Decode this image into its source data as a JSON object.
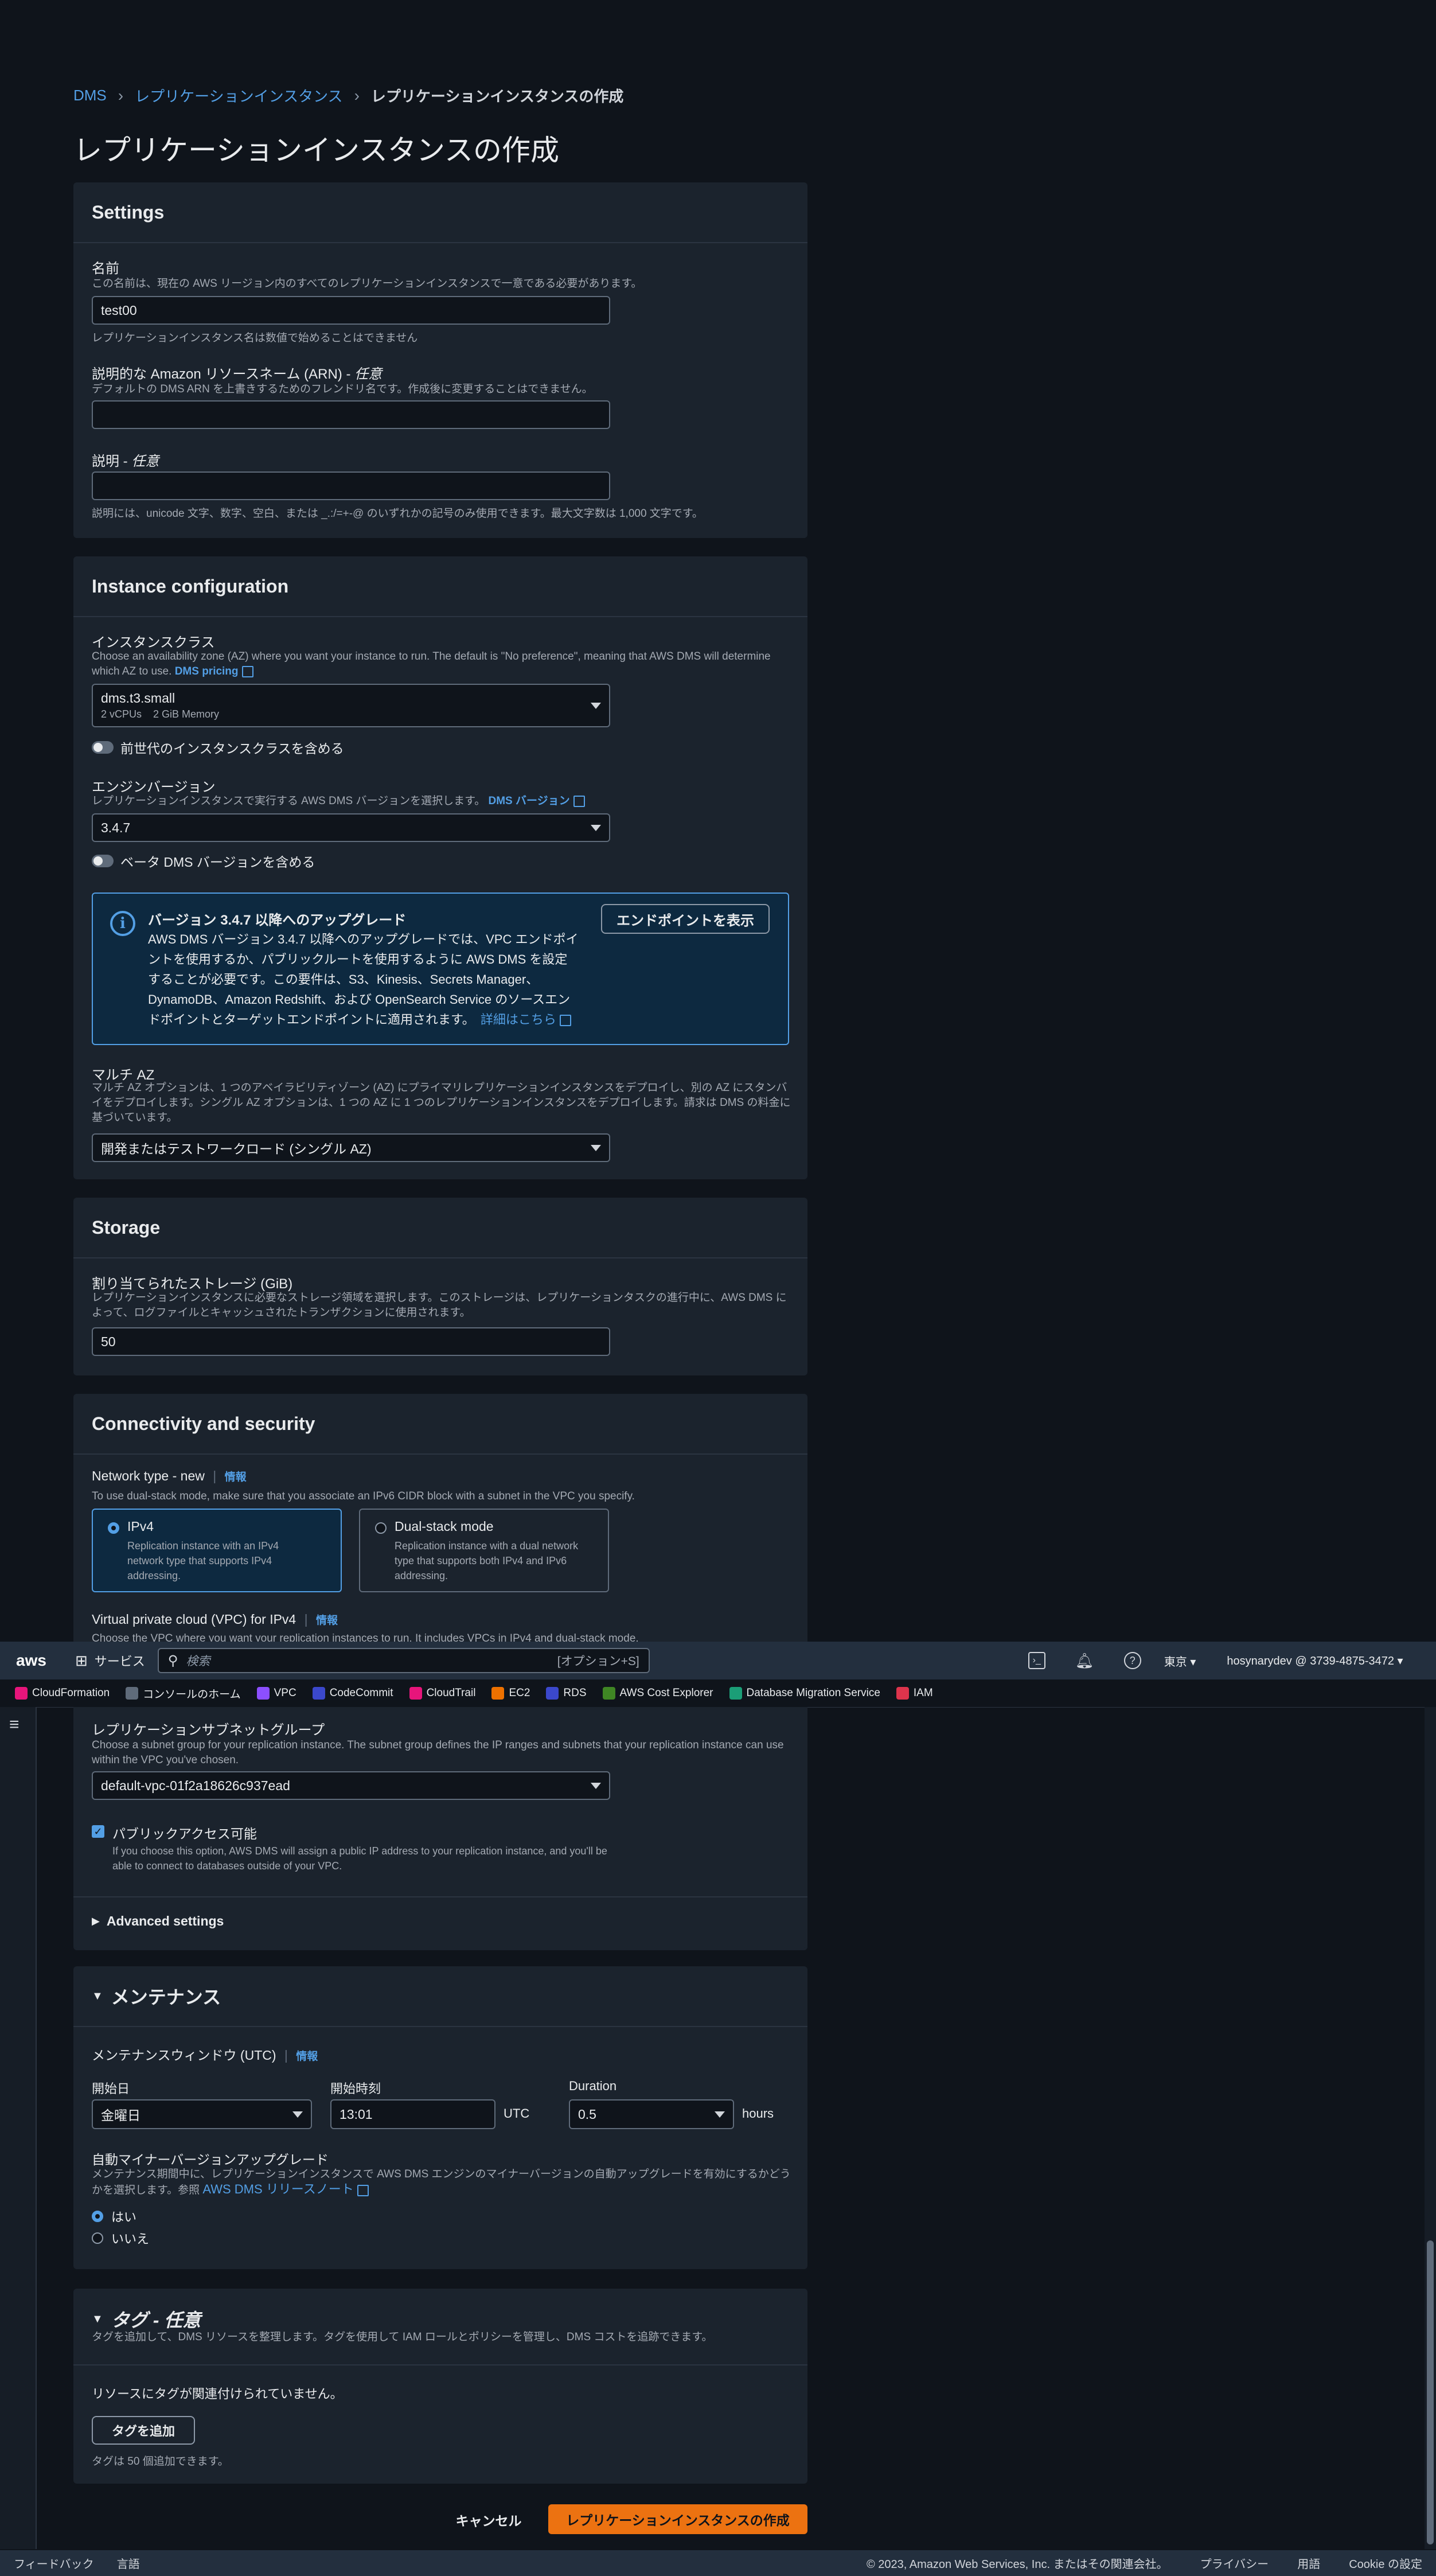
{
  "breadcrumb": {
    "items": [
      "DMS",
      "レプリケーションインスタンス"
    ],
    "current": "レプリケーションインスタンスの作成"
  },
  "page_title": "レプリケーションインスタンスの作成",
  "settings": {
    "title": "Settings",
    "name_label": "名前",
    "name_desc": "この名前は、現在の AWS リージョン内のすべてのレプリケーションインスタンスで一意である必要があります。",
    "name_value": "test00",
    "name_hint": "レプリケーションインスタンス名は数値で始めることはできません",
    "arn_label": "説明的な Amazon リソースネーム (ARN) - ",
    "arn_optional": "任意",
    "arn_desc": "デフォルトの DMS ARN を上書きするためのフレンドリ名です。作成後に変更することはできません。",
    "desc_label": "説明 - ",
    "desc_optional": "任意",
    "desc_hint": "説明には、unicode 文字、数字、空白、または _.:/=+-@ のいずれかの記号のみ使用できます。最大文字数は 1,000 文字です。"
  },
  "instance": {
    "title": "Instance configuration",
    "class_label": "インスタンスクラス",
    "class_desc": "Choose an availability zone (AZ) where you want your instance to run. The default is \"No preference\", meaning that AWS DMS will determine which AZ to use.",
    "class_link": "DMS pricing",
    "class_value": "dms.t3.small",
    "class_sub": "2 vCPUs    2 GiB Memory",
    "prev_gen_label": "前世代のインスタンスクラスを含める",
    "engine_label": "エンジンバージョン",
    "engine_desc": "レプリケーションインスタンスで実行する AWS DMS バージョンを選択します。",
    "engine_link": "DMS バージョン",
    "engine_value": "3.4.7",
    "beta_label": "ベータ DMS バージョンを含める",
    "alert_title": "バージョン 3.4.7 以降へのアップグレード",
    "alert_line1": "AWS DMS バージョン 3.4.7 以降へのアップグレードでは、VPC エンドポイ",
    "alert_line2": "ントを使用するか、パブリックルートを使用するように AWS DMS を設定",
    "alert_line3": "することが必要です。この要件は、S3、Kinesis、Secrets Manager、",
    "alert_line4": "DynamoDB、Amazon Redshift、および OpenSearch Service のソースエン",
    "alert_line5": "ドポイントとターゲットエンドポイントに適用されます。",
    "alert_link": "詳細はこちら",
    "alert_button": "エンドポイントを表示",
    "multiaz_label": "マルチ AZ",
    "multiaz_desc": "マルチ AZ オプションは、1 つのアベイラビリティゾーン (AZ) にプライマリレプリケーションインスタンスをデプロイし、別の AZ にスタンバイをデプロイします。シングル AZ オプションは、1 つの AZ に 1 つのレプリケーションインスタンスをデプロイします。請求は DMS の料金に基づいています。",
    "multiaz_value": "開発またはテストワークロード (シングル AZ)"
  },
  "storage": {
    "title": "Storage",
    "label": "割り当てられたストレージ (GiB)",
    "desc": "レプリケーションインスタンスに必要なストレージ領域を選択します。このストレージは、レプリケーションタスクの進行中に、AWS DMS によって、ログファイルとキャッシュされたトランザクションに使用されます。",
    "value": "50"
  },
  "connectivity": {
    "title": "Connectivity and security",
    "network_label": "Network type - new",
    "info": "情報",
    "network_desc": "To use dual-stack mode, make sure that you associate an IPv6 CIDR block with a subnet in the VPC you specify.",
    "ipv4_title": "IPv4",
    "ipv4_desc": "Replication instance with an IPv4 network type that supports IPv4 addressing.",
    "dual_title": "Dual-stack mode",
    "dual_desc": "Replication instance with a dual network type that supports both IPv4 and IPv6 addressing.",
    "vpc_label": "Virtual private cloud (VPC) for IPv4",
    "vpc_desc": "Choose the VPC where you want your replication instances to run. It includes VPCs in IPv4 and dual-stack mode.",
    "subnet_label": "レプリケーションサブネットグループ",
    "subnet_desc": "Choose a subnet group for your replication instance. The subnet group defines the IP ranges and subnets that your replication instance can use within the VPC you've chosen.",
    "subnet_value": "default-vpc-01f2a18626c937ead",
    "public_label": "パブリックアクセス可能",
    "public_desc": "If you choose this option, AWS DMS will assign a public IP address to your replication instance, and you'll be able to connect to databases outside of your VPC.",
    "advanced": "Advanced settings"
  },
  "maintenance": {
    "title": "メンテナンス",
    "window_label": "メンテナンスウィンドウ (UTC)",
    "info": "情報",
    "start_day_label": "開始日",
    "start_day_value": "金曜日",
    "start_time_label": "開始時刻",
    "start_time_value": "13:01",
    "utc": "UTC",
    "duration_label": "Duration",
    "duration_value": "0.5",
    "hours": "hours",
    "auto_label": "自動マイナーバージョンアップグレード",
    "auto_desc": "メンテナンス期間中に、レプリケーションインスタンスで AWS DMS エンジンのマイナーバージョンの自動アップグレードを有効にするかどうかを選択します。参照",
    "auto_link": "AWS DMS リリースノート",
    "yes": "はい",
    "no": "いいえ"
  },
  "tags": {
    "title": "タグ - 任意",
    "desc": "タグを追加して、DMS リソースを整理します。タグを使用して IAM ロールとポリシーを管理し、DMS コストを追跡できます。",
    "empty": "リソースにタグが関連付けられていません。",
    "add_button": "タグを追加",
    "limit": "タグは 50 個追加できます。"
  },
  "actions": {
    "cancel": "キャンセル",
    "create": "レプリケーションインスタンスの作成"
  },
  "topnav": {
    "logo": "aws",
    "services": "サービス",
    "search_placeholder": "検索",
    "search_shortcut": "[オプション+S]",
    "region": "東京",
    "account": "hosynarydev @ 3739-4875-3472"
  },
  "favorites": [
    {
      "label": "CloudFormation",
      "color": "#e7157b"
    },
    {
      "label": "コンソールのホーム",
      "color": "#5f6b7a"
    },
    {
      "label": "VPC",
      "color": "#8c4fff"
    },
    {
      "label": "CodeCommit",
      "color": "#3b48cc"
    },
    {
      "label": "CloudTrail",
      "color": "#e7157b"
    },
    {
      "label": "EC2",
      "color": "#ed7100"
    },
    {
      "label": "RDS",
      "color": "#3b48cc"
    },
    {
      "label": "AWS Cost Explorer",
      "color": "#3f8624"
    },
    {
      "label": "Database Migration Service",
      "color": "#1b9e77"
    },
    {
      "label": "IAM",
      "color": "#dd344c"
    }
  ],
  "footer": {
    "feedback": "フィードバック",
    "language": "言語",
    "copyright": "© 2023, Amazon Web Services, Inc. またはその関連会社。",
    "privacy": "プライバシー",
    "terms": "用語",
    "cookie": "Cookie の設定"
  },
  "colors": {
    "accent": "#539fe5",
    "primary_button": "#ec7211",
    "background": "#0f141b",
    "panel": "#1b232d"
  }
}
